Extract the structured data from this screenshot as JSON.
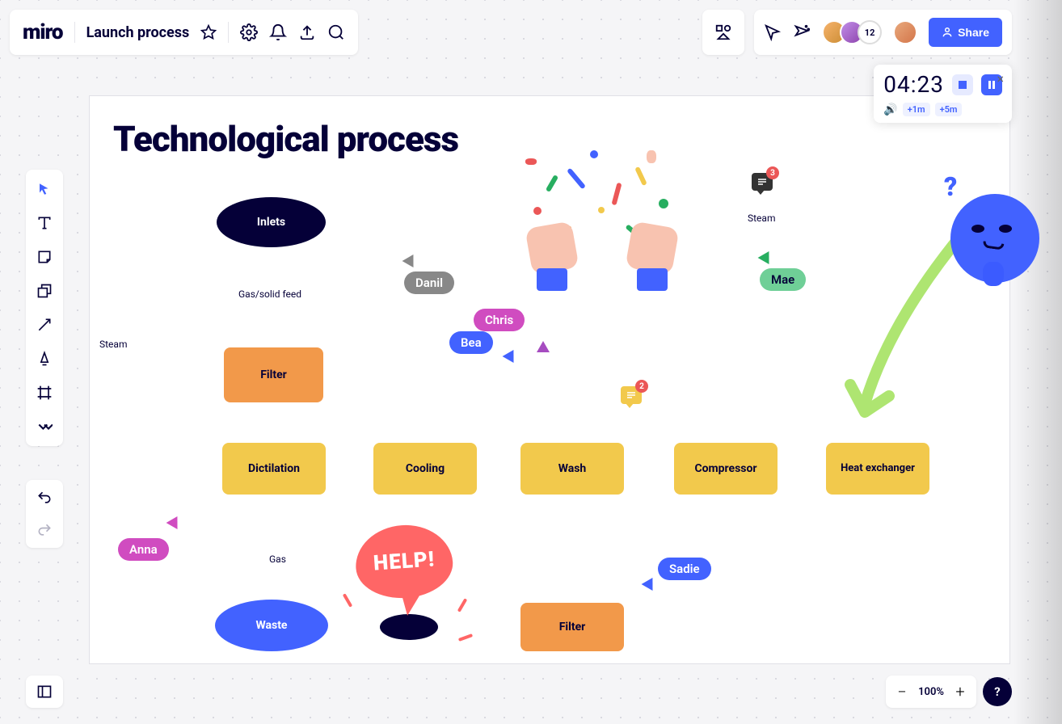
{
  "app": {
    "name": "miro",
    "board": "Launch process"
  },
  "share": {
    "label": "Share"
  },
  "avatars": {
    "extra_count": "12"
  },
  "timer": {
    "time": "04:23",
    "add1": "+1m",
    "add5": "+5m"
  },
  "zoom": {
    "percent": "100%"
  },
  "help_btn": "?",
  "frame": {
    "title": "Technological process"
  },
  "nodes": {
    "inlets": "Inlets",
    "filter1": "Filter",
    "dictilation": "Dictilation",
    "cooling": "Cooling",
    "wash": "Wash",
    "compressor": "Compressor",
    "heat_exchanger": "Heat exchanger",
    "waste": "Waste",
    "filter2": "Filter"
  },
  "edges": {
    "steam1": "Steam",
    "gas_feed": "Gas/solid feed",
    "steam2": "Steam",
    "gas": "Gas"
  },
  "cursors": {
    "danil": "Danil",
    "chris": "Chris",
    "bea": "Bea",
    "mae": "Mae",
    "anna": "Anna",
    "sadie": "Sadie"
  },
  "comments": {
    "dark_count": "3",
    "yellow_count": "2"
  },
  "stickers": {
    "help": "HELP!"
  },
  "colors": {
    "navy": "#050038",
    "blue": "#4262ff",
    "yellow": "#f2c94c",
    "orange": "#f2994a",
    "red": "#eb5757",
    "green": "#27ae60",
    "pink": "#d04cc0",
    "gray": "#888888"
  }
}
